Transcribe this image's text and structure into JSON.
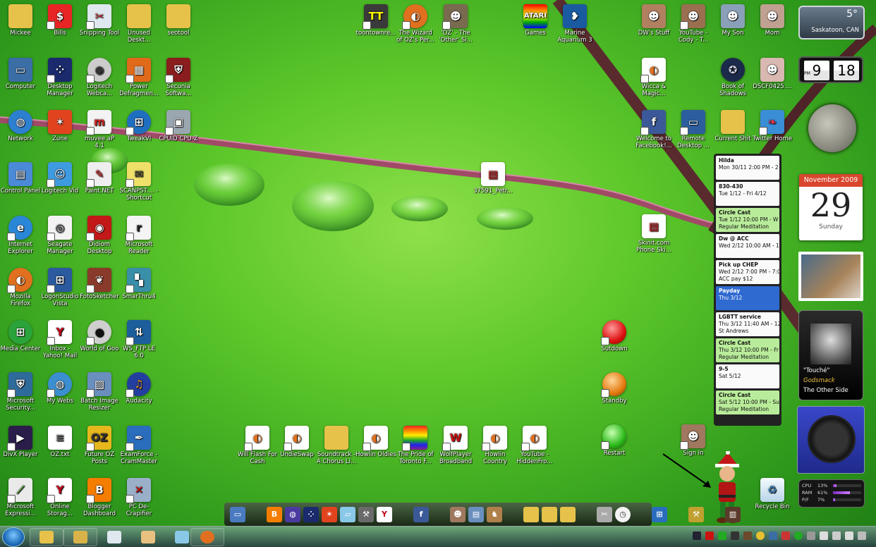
{
  "desktop_icons": {
    "mickee": "Mickee",
    "bills": "Bills",
    "snipping": "Snipping Tool",
    "unused": "Unused Deskt...",
    "seotool": "seotool",
    "computer": "Computer",
    "desktop_manager": "Desktop Manager",
    "logitech_webcam": "Logitech Webca...",
    "power_defrag": "Power Defragmen...",
    "secunia": "Secunia Softwa...",
    "network": "Network",
    "zune": "Zune",
    "muvee": "muvee aP 4.1",
    "tweakvi": "TweakVI",
    "cpuz": "CPUID CPU-Z",
    "control_panel": "Control Panel",
    "logitech_vid": "Logitech Vid",
    "paintnet": "Paint.NET",
    "scanpst": "SCANPST.... - Shortcut",
    "internet_explorer": "Internet Explorer",
    "seagate": "Seagate Manager",
    "didiom": "Didiom Desktop",
    "ms_reader": "Microsoft Reader",
    "firefox": "Mozilla Firefox",
    "logonstudio": "LogonStudio Vista",
    "fotosketcher": "FotoSketcher",
    "smarthru": "SmarThru4",
    "media_center": "Media Center",
    "yahoo_mail": "Inbox - Yahoo! Mail",
    "world_of_goo": "World of Goo",
    "wsftp": "WS_FTP LE 6.0",
    "ms_security": "Microsoft Security...",
    "my_webs": "My Webs",
    "batch_resizer": "Batch Image Resizer",
    "audacity": "Audacity",
    "divx": "DivX Player",
    "oz_txt": "OZ.txt",
    "future_oz": "Future OZ Posts",
    "examforce": "ExamForce - CramMaster",
    "ms_expression": "Microsoft Expressi...",
    "yahoo_storage": "Online Storag...",
    "blogger": "Blogger Dashboard",
    "decrapifier": "PC De-Crapifier",
    "toontown": "toontownre...",
    "wizard_oz": "The Wizard of OZ's Per...",
    "oz_other": "'OZ' - The 'Other' Si...",
    "atari": "Games",
    "marine": "Marine Aquarium 3",
    "dws_stuff": "DW's Stuff",
    "youtube_cody": "YouTube - Cody - T...",
    "my_son": "My Son",
    "mom": "Mom",
    "wicca": "Wicca & Magic...",
    "book_shadows": "Book of Shadows",
    "dscf": "DSCF0425....",
    "facebook": "Welcome to Facebook!...",
    "remote_desktop": "Remote Desktop ...",
    "current_shit": "Current Shit",
    "twitter": "Twitter Home",
    "pdf_doc": "37591_Petr...",
    "skinit": "Skinit.com Phone Ski...",
    "shutdown": "Sutdown",
    "standby": "Standby",
    "restart": "Restart",
    "sign_in": "Sign In",
    "recycle_bin": "Recycle Bin",
    "will_flash": "Will Flash For Cash",
    "undieswap": "UndieSwap",
    "soundtrack": "Soundtrack - A Chorus Li...",
    "howlin_oldies": "Howlin Oldies",
    "pride_toronto": "The Pride of Toronto F...",
    "wolfplayer": "WolfPlayer Broadband",
    "howlin_country": "Howlin Country",
    "youtube_hidden": "YouTube - HiddenFro..."
  },
  "gadgets": {
    "weather": {
      "temp": "5°",
      "city": "Saskatoon, CAN"
    },
    "clock": {
      "ampm": "PM",
      "hour": "9",
      "minute": "18"
    },
    "calendar": {
      "month": "November 2009",
      "day": "29",
      "weekday": "Sunday"
    },
    "media": {
      "track": "\"Touché\"",
      "artist": "Godsmack",
      "album": "The Other Side"
    },
    "cpu_meter": {
      "cpu_label": "CPU",
      "cpu_value": "13%",
      "cpu_level": 0.13,
      "ram_label": "RAM",
      "ram_value": "61%",
      "ram_level": 0.61,
      "pf_label": "P/F",
      "pf_value": "7%",
      "pf_level": 0.07
    },
    "events": [
      {
        "title": "Hilda",
        "line2": "Mon 30/11 2:00 PM - 2",
        "line3": "",
        "color": "white"
      },
      {
        "title": "830-430",
        "line2": "Tue 1/12 - Fri 4/12",
        "line3": "",
        "color": "white"
      },
      {
        "title": "Circle Cast",
        "line2": "Tue 1/12 10:00 PM - W",
        "line3": "Regular Meditation",
        "color": "green"
      },
      {
        "title": "Dw @ ACC",
        "line2": "Wed 2/12 10:00 AM - 1",
        "line3": "",
        "color": "white"
      },
      {
        "title": "Pick up CHEP",
        "line2": "Wed 2/12 7:00 PM - 7:0",
        "line3": "ACC pay $12",
        "color": "white"
      },
      {
        "title": "Payday",
        "line2": "Thu 3/12",
        "line3": "",
        "color": "blue"
      },
      {
        "title": "LGBTT service",
        "line2": "Thu 3/12 11:40 AM - 12",
        "line3": "St Andrews",
        "color": "white"
      },
      {
        "title": "Circle Cast",
        "line2": "Thu 3/12 10:00 PM - Fr",
        "line3": "Regular Meditation",
        "color": "green"
      },
      {
        "title": "9-5",
        "line2": "Sat 5/12",
        "line3": "",
        "color": "white"
      },
      {
        "title": "Circle Cast",
        "line2": "Sat 5/12 10:00 PM - Su",
        "line3": "Regular Meditation",
        "color": "green"
      }
    ]
  },
  "colors": {
    "accent": "#2f6ad0",
    "wallpaper_green": "#5cc72a",
    "branch": "#9b4a62"
  }
}
